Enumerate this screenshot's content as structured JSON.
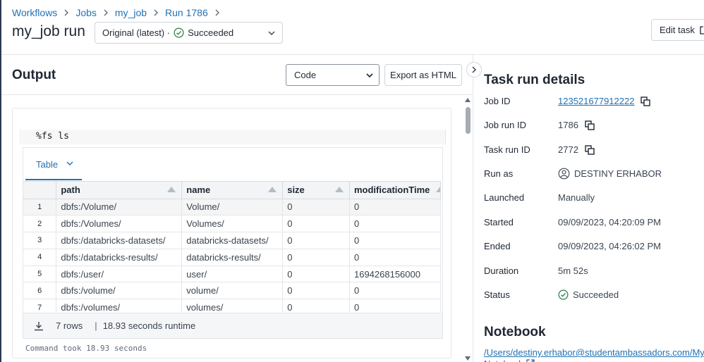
{
  "breadcrumb": [
    "Workflows",
    "Jobs",
    "my_job",
    "Run 1786"
  ],
  "page_title": "my_job run",
  "run_select": {
    "version": "Original (latest) ·",
    "status": "Succeeded"
  },
  "edit_task_label": "Edit task",
  "output": {
    "title": "Output",
    "view_selected": "Code",
    "view_options": [
      "Code"
    ],
    "export_label": "Export as HTML",
    "command": "%fs ls",
    "tab_label": "Table",
    "columns": [
      "path",
      "name",
      "size",
      "modificationTime"
    ],
    "rows": [
      [
        "dbfs:/Volume/",
        "Volume/",
        "0",
        "0"
      ],
      [
        "dbfs:/Volumes/",
        "Volumes/",
        "0",
        "0"
      ],
      [
        "dbfs:/databricks-datasets/",
        "databricks-datasets/",
        "0",
        "0"
      ],
      [
        "dbfs:/databricks-results/",
        "databricks-results/",
        "0",
        "0"
      ],
      [
        "dbfs:/user/",
        "user/",
        "0",
        "1694268156000"
      ],
      [
        "dbfs:/volume/",
        "volume/",
        "0",
        "0"
      ],
      [
        "dbfs:/volumes/",
        "volumes/",
        "0",
        "0"
      ]
    ],
    "row_count": "7 rows",
    "runtime": "18.93 seconds runtime",
    "command_took": "Command took 18.93 seconds"
  },
  "details": {
    "title": "Task run details",
    "job_id_label": "Job ID",
    "job_id": "123521677912222",
    "job_run_id_label": "Job run ID",
    "job_run_id": "1786",
    "task_run_id_label": "Task run ID",
    "task_run_id": "2772",
    "run_as_label": "Run as",
    "run_as": "DESTINY ERHABOR",
    "launched_label": "Launched",
    "launched": "Manually",
    "started_label": "Started",
    "started": "09/09/2023, 04:20:09 PM",
    "ended_label": "Ended",
    "ended": "09/09/2023, 04:26:02 PM",
    "duration_label": "Duration",
    "duration": "5m 52s",
    "status_label": "Status",
    "status": "Succeeded"
  },
  "notebook": {
    "title": "Notebook",
    "path": "/Users/destiny.erhabor@studentambassadors.com/My Notebook"
  },
  "colors": {
    "link": "#2272b4",
    "success": "#277c43",
    "text": "#1f2733",
    "border": "#e2e6ea"
  },
  "icons": [
    "chevron-right-icon",
    "check-circle-icon",
    "chevron-down-icon",
    "external-link-icon",
    "sort-icon",
    "download-icon",
    "copy-icon",
    "user-icon",
    "scroll-up-icon",
    "scroll-down-icon"
  ]
}
